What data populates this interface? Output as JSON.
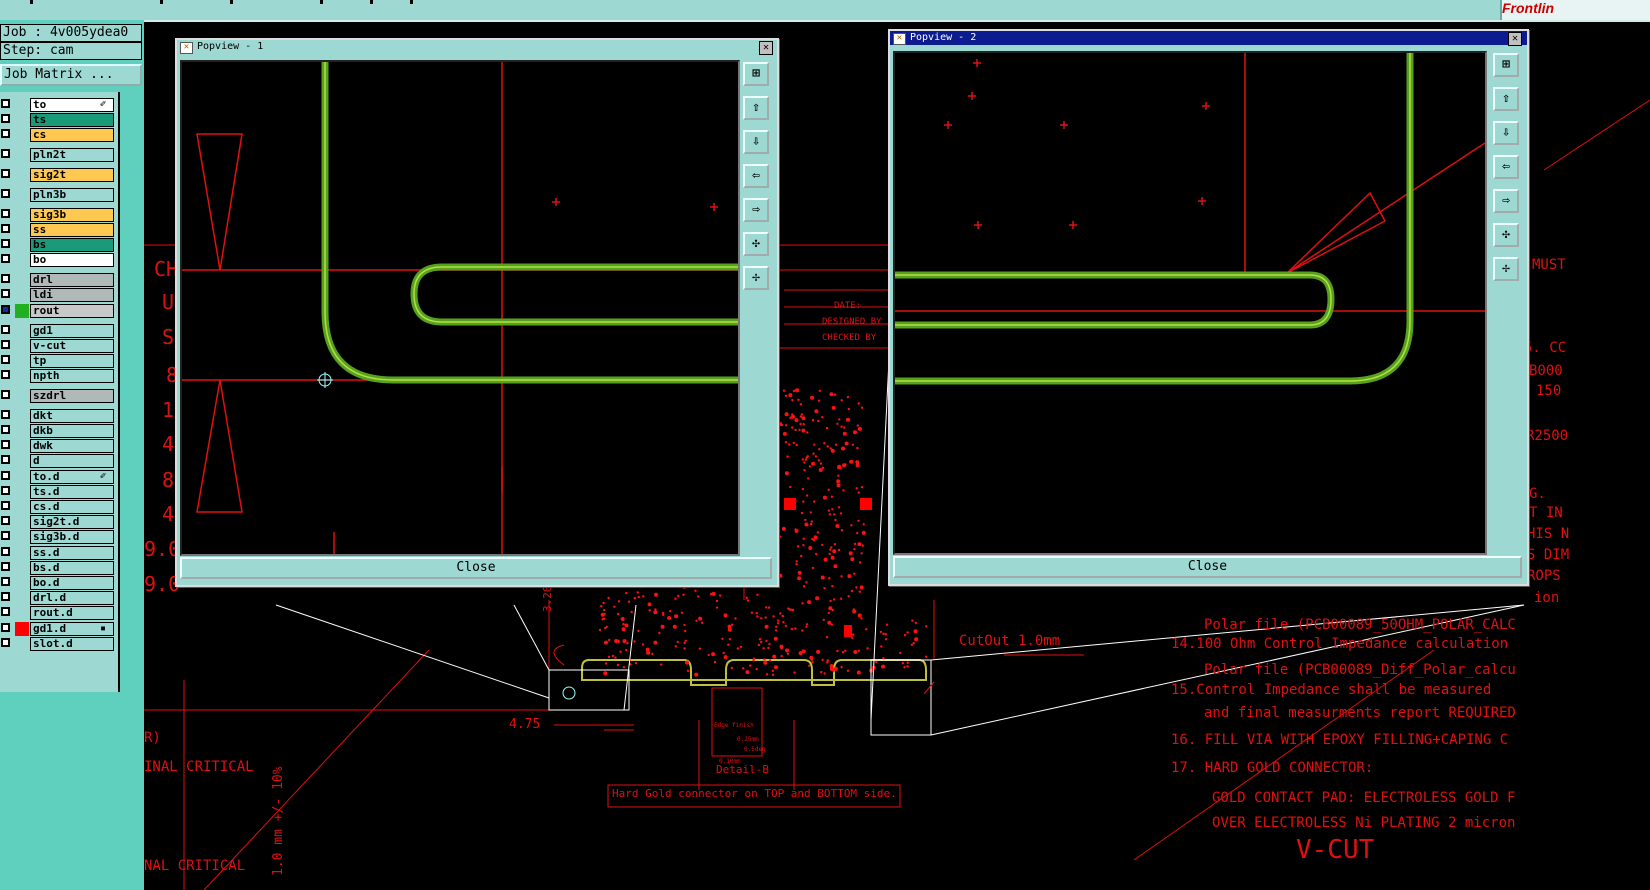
{
  "layer_info": {
    "job": "Job : 4v005ydea0",
    "step": "Step: cam",
    "job_matrix": "Job Matrix ..."
  },
  "top_logo": "Frontlin",
  "layers": [
    {
      "name": "to",
      "color": "#ffffff",
      "mark": "✐"
    },
    {
      "name": "ts",
      "color": "#1a9a78"
    },
    {
      "name": "cs",
      "color": "#ffc850"
    },
    {
      "name": "pln2t",
      "color": "#9dd9d2"
    },
    {
      "name": "sig2t",
      "color": "#ffc850"
    },
    {
      "name": "pln3b",
      "color": "#9dd9d2"
    },
    {
      "name": "sig3b",
      "color": "#ffc850"
    },
    {
      "name": "ss",
      "color": "#ffc850"
    },
    {
      "name": "bs",
      "color": "#1a9a78"
    },
    {
      "name": "bo",
      "color": "#ffffff"
    },
    {
      "name": "drl",
      "color": "#b0b8b8"
    },
    {
      "name": "ldi",
      "color": "#b0b8b8"
    },
    {
      "name": "rout",
      "color": "#c8c8c8",
      "selected": true,
      "swatch": "#20b020"
    },
    {
      "name": "gd1",
      "color": "#9dd9d2"
    },
    {
      "name": "v-cut",
      "color": "#9dd9d2"
    },
    {
      "name": "tp",
      "color": "#9dd9d2"
    },
    {
      "name": "npth",
      "color": "#9dd9d2"
    },
    {
      "name": "szdrl",
      "color": "#b0b8b8"
    },
    {
      "name": "dkt",
      "color": "#9dd9d2"
    },
    {
      "name": "dkb",
      "color": "#9dd9d2"
    },
    {
      "name": "dwk",
      "color": "#9dd9d2"
    },
    {
      "name": "d",
      "color": "#9dd9d2"
    },
    {
      "name": "to.d",
      "color": "#9dd9d2",
      "mark": "✐"
    },
    {
      "name": "ts.d",
      "color": "#9dd9d2"
    },
    {
      "name": "cs.d",
      "color": "#9dd9d2"
    },
    {
      "name": "sig2t.d",
      "color": "#9dd9d2"
    },
    {
      "name": "sig3b.d",
      "color": "#9dd9d2"
    },
    {
      "name": "ss.d",
      "color": "#9dd9d2"
    },
    {
      "name": "bs.d",
      "color": "#9dd9d2"
    },
    {
      "name": "bo.d",
      "color": "#9dd9d2"
    },
    {
      "name": "drl.d",
      "color": "#9dd9d2"
    },
    {
      "name": "rout.d",
      "color": "#9dd9d2"
    },
    {
      "name": "gd1.d",
      "color": "#9dd9d2",
      "swatch": "#ff0000",
      "mark": "▪"
    },
    {
      "name": "slot.d",
      "color": "#9dd9d2"
    }
  ],
  "popview1": {
    "title": "Popview - 1",
    "close": "Close"
  },
  "popview2": {
    "title": "Popview - 2",
    "close": "Close"
  },
  "drawing": {
    "title_block": {
      "date": "DATE:",
      "designed_by": "DESIGNED BY",
      "checked_by": "CHECKED BY"
    },
    "cutout_label": "CutOut 1.0mm",
    "dim_left": "4.75",
    "dim_vert": "3.20",
    "detail_label": "Detail-B",
    "edge_label": "Edge finish",
    "detail_dim1": "0.25mm",
    "detail_dim2": "0.10mm",
    "detail_dim3": "0.5deg",
    "hard_gold_box": "Hard Gold connector on TOP and BOTTOM side.",
    "left_notes": [
      "R)",
      "INAL CRITICAL",
      "NAL CRITICAL"
    ],
    "vert_note": "1.0 mm +/- 10%",
    "left_frag": [
      "CH",
      "U",
      "S",
      "8",
      "1",
      "4",
      "8",
      "4",
      "9.0",
      "9.0"
    ],
    "right_frag": [
      "MUST",
      "5. CC",
      "B000",
      "150",
      "R2500",
      "G.",
      "T IN",
      "HIS N",
      "S DIM",
      "ROPS",
      "ion"
    ],
    "notes": [
      "Polar file (PCB00089_50OHM_POLAR_CALC",
      "14.100 Ohm Control Impedance calculation",
      "Polar file (PCB00089_Diff_Polar_calcu",
      "15.Control Impedance shall be measured",
      "and final measurments report REQUIRED",
      "16. FILL VIA WITH EPOXY FILLING+CAPING C",
      "17. HARD GOLD CONNECTOR:",
      "GOLD CONTACT PAD: ELECTROLESS GOLD F",
      "OVER ELECTROLESS Ni PLATING 2 micron",
      "V-CUT"
    ]
  }
}
